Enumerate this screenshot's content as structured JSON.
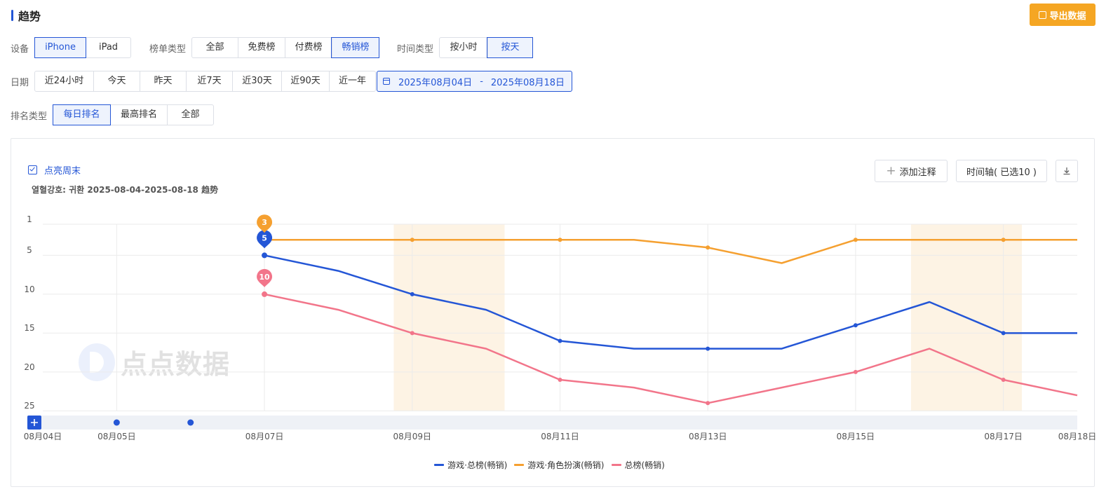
{
  "header": {
    "title": "趋势",
    "export_label": "导出数据"
  },
  "filters": {
    "device": {
      "label": "设备",
      "options": [
        "iPhone",
        "iPad"
      ],
      "active": 0
    },
    "rank_list_type": {
      "label": "榜单类型",
      "options": [
        "全部",
        "免费榜",
        "付费榜",
        "畅销榜"
      ],
      "active": 3
    },
    "time_type": {
      "label": "时间类型",
      "options": [
        "按小时",
        "按天"
      ],
      "active": 1
    },
    "date": {
      "label": "日期",
      "options": [
        "近24小时",
        "今天",
        "昨天",
        "近7天",
        "近30天",
        "近90天",
        "近一年"
      ],
      "range_start": "2025年08月04日",
      "range_sep": "-",
      "range_end": "2025年08月18日"
    },
    "rank_type": {
      "label": "排名类型",
      "options": [
        "每日排名",
        "最高排名",
        "全部"
      ],
      "active": 0
    }
  },
  "panel": {
    "weekend_toggle_label": "点亮周末",
    "weekend_checked": true,
    "subtitle": "열혈강호: 귀환 2025-08-04-2025-08-18 趋势",
    "add_note_label": "添加注释",
    "timeline_label": "时间轴( 已选10 )",
    "watermark": "点点数据"
  },
  "chart_data": {
    "type": "line",
    "title": "",
    "x": [
      "08月04日",
      "08月05日",
      "08月06日",
      "08月07日",
      "08月08日",
      "08月09日",
      "08月10日",
      "08月11日",
      "08月12日",
      "08月13日",
      "08月14日",
      "08月15日",
      "08月16日",
      "08月17日",
      "08月18日"
    ],
    "x_tick_labels": [
      "08月04日",
      "08月05日",
      "08月07日",
      "08月09日",
      "08月11日",
      "08月13日",
      "08月15日",
      "08月17日",
      "08月18日"
    ],
    "y_ticks": [
      1,
      5,
      10,
      15,
      20,
      25
    ],
    "y_range": [
      1,
      25
    ],
    "y_reversed": true,
    "grid": true,
    "weekend_bands": [
      [
        "08月09日",
        "08月10日"
      ],
      [
        "08月16日",
        "08月17日"
      ]
    ],
    "annotation_dots": [
      "08月05日",
      "08月06日"
    ],
    "series": [
      {
        "name": "游戏·总榜(畅销)",
        "color": "#2456d6",
        "values": [
          null,
          null,
          null,
          5,
          7,
          10,
          12,
          16,
          17,
          17,
          17,
          14,
          11,
          15,
          15
        ],
        "marker_label": "5"
      },
      {
        "name": "游戏·角色扮演(畅销)",
        "color": "#f5a030",
        "values": [
          null,
          null,
          null,
          3,
          3,
          3,
          3,
          3,
          3,
          4,
          6,
          3,
          3,
          3,
          3
        ],
        "marker_label": "3"
      },
      {
        "name": "总榜(畅销)",
        "color": "#f2758a",
        "values": [
          null,
          null,
          null,
          10,
          12,
          15,
          17,
          21,
          22,
          24,
          22,
          20,
          17,
          21,
          23
        ],
        "marker_label": "10"
      }
    ],
    "legend_position": "bottom-center"
  }
}
